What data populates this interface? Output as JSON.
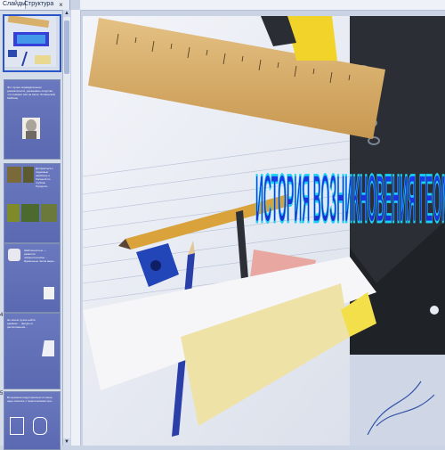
{
  "panel": {
    "tabs": [
      "Слайды",
      "Структура"
    ],
    "close_glyph": "×"
  },
  "thumbnails": [
    {
      "num": "",
      "kind": "title-image"
    },
    {
      "num": "",
      "kind": "text-portrait",
      "text": "Это лучше оправдательных доказательств, доказывать сходство, что поможет всё на свете. Лопаньский, Лейбниц"
    },
    {
      "num": "",
      "kind": "photo-grid",
      "text": "Доторкиться к подножью наиболее и большой по глубине Геродота..."
    },
    {
      "num": "",
      "kind": "text-figures",
      "text": "Шаблонностью — развития поворотоосновы ... Идеальные числа меры..."
    },
    {
      "num": "4",
      "kind": "text-figure",
      "text": "Не зачем лучше найти древние ... фигуры и расположения..."
    },
    {
      "num": "5",
      "kind": "text-figures",
      "text": "Во времена индустриально по меня, надо отвечать с практическими при..."
    }
  ],
  "slide": {
    "title": "ИСТОРИЯ ВОЗНИКНОВЕНИЯ ГЕОМЕТРИИ"
  },
  "colors": {
    "title_fill": "#1e2bd8",
    "title_stroke": "#1bd0f2",
    "thumb_bg": "#6372bb"
  }
}
